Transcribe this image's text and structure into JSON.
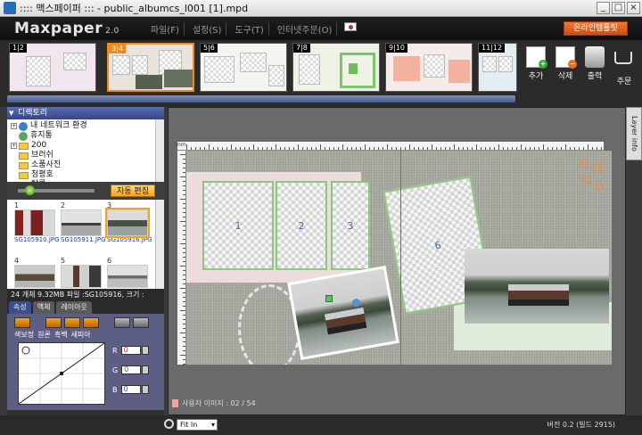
{
  "window": {
    "title": ":::: 맥스페이퍼 :::  - public_albumcs_l001 [1].mpd",
    "buttons": {
      "minimize": "_",
      "maximize": "□",
      "close": "×"
    }
  },
  "header": {
    "logo": "Maxpaper",
    "version_badge": "2.0",
    "menus": [
      "파일(F)",
      "설정(S)",
      "도구(T)",
      "인터넷주문(O)"
    ],
    "online_button": "온라인템플릿"
  },
  "thumbnails": [
    {
      "label": "1|2",
      "active": false
    },
    {
      "label": "3|4",
      "active": true
    },
    {
      "label": "5|6",
      "active": false
    },
    {
      "label": "7|8",
      "active": false
    },
    {
      "label": "9|10",
      "active": false
    },
    {
      "label": "11|12",
      "active": false
    }
  ],
  "tools": [
    {
      "label": "추가",
      "icon": "add-page-icon"
    },
    {
      "label": "삭제",
      "icon": "delete-page-icon"
    },
    {
      "label": "출력",
      "icon": "printer-icon"
    },
    {
      "label": "주문",
      "icon": "cart-icon"
    }
  ],
  "directory": {
    "title": "디렉토리",
    "tree": [
      {
        "label": "내 네트워크 환경",
        "type": "network",
        "expand": "+"
      },
      {
        "label": "휴지통",
        "type": "recycle",
        "expand": ""
      },
      {
        "label": "200",
        "type": "folder",
        "expand": "+"
      },
      {
        "label": "브러쉬",
        "type": "folder",
        "expand": ""
      },
      {
        "label": "소품사진",
        "type": "folder",
        "expand": ""
      },
      {
        "label": "청평호",
        "type": "folder",
        "expand": ""
      },
      {
        "label": "탈록",
        "type": "folder",
        "expand": ""
      }
    ]
  },
  "photo_panel": {
    "auto_edit": "자동 편집",
    "photos": [
      {
        "num": "1",
        "caption": "SG105910.JPG"
      },
      {
        "num": "2",
        "caption": "SG105911.JPG"
      },
      {
        "num": "3",
        "caption": "SG105916.JPG"
      },
      {
        "num": "4",
        "caption": ""
      },
      {
        "num": "5",
        "caption": ""
      },
      {
        "num": "6",
        "caption": ""
      }
    ],
    "status": "24 개체      9.32MB      파일 :SG105916, 크기 :"
  },
  "props": {
    "tabs": [
      "속성",
      "액체",
      "레이아웃"
    ],
    "filter_labels": [
      "색보정",
      "원론",
      "흑백",
      "세피아"
    ],
    "channels": [
      {
        "name": "R",
        "value": "0"
      },
      {
        "name": "G",
        "value": "0"
      },
      {
        "name": "B",
        "value": "0"
      }
    ]
  },
  "canvas": {
    "layer_info_tab": "Layer info",
    "unit": "mm",
    "slots": [
      "1",
      "2",
      "3",
      "6"
    ],
    "footer_status": "사용자 이미지 : 02 / 54"
  },
  "bottombar": {
    "zoom_value": "Fit In",
    "version": "버전 0.2 (빌드 2915)"
  },
  "colors": {
    "accent": "#f08a1c",
    "panel_header": "#34468a",
    "slot_border": "#8ec77f"
  }
}
